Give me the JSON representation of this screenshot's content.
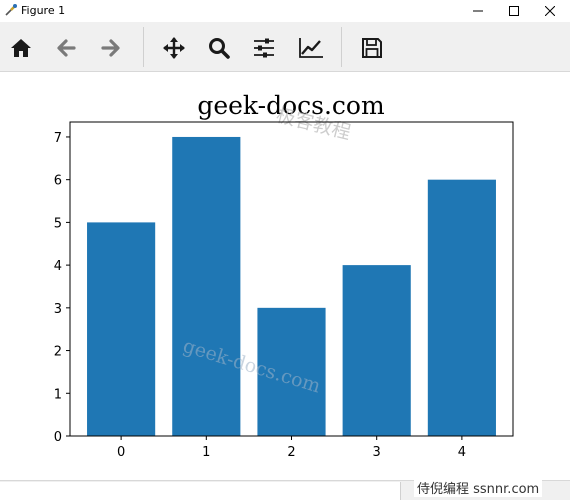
{
  "window": {
    "title": "Figure 1"
  },
  "toolbar": {
    "buttons": [
      {
        "icon": "home-icon"
      },
      {
        "icon": "back-arrow-icon"
      },
      {
        "icon": "forward-arrow-icon"
      },
      {
        "icon": "pan-move-icon"
      },
      {
        "icon": "zoom-magnifier-icon"
      },
      {
        "icon": "configure-subplots-icon"
      },
      {
        "icon": "edit-axis-icon"
      },
      {
        "icon": "save-floppy-icon"
      }
    ]
  },
  "chart_data": {
    "type": "bar",
    "title": "geek-docs.com",
    "categories": [
      "0",
      "1",
      "2",
      "3",
      "4"
    ],
    "values": [
      5,
      7,
      3,
      4,
      6
    ],
    "xlim": [
      -0.6,
      4.6
    ],
    "ylim": [
      0,
      7.35
    ],
    "yticks": [
      "0",
      "1",
      "2",
      "3",
      "4",
      "5",
      "6",
      "7"
    ],
    "xlabel": "",
    "ylabel": "",
    "bar_color": "#1f77b4",
    "grid": false
  },
  "watermarks": {
    "top": "极客教程",
    "middle": "geek-docs.com"
  },
  "statusbar": {
    "brand": "侍倪编程 ssnnr.com"
  }
}
